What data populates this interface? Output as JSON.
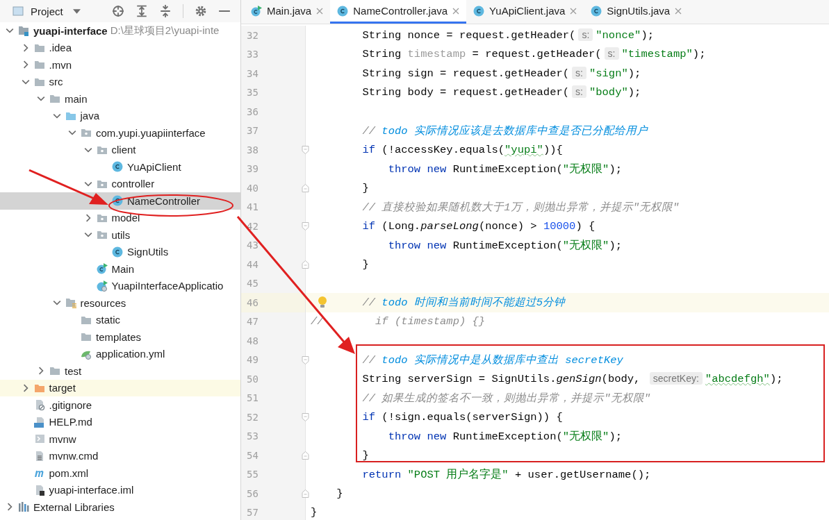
{
  "project_panel": {
    "title": "Project",
    "tree": [
      {
        "label": "yuapi-interface",
        "path": "D:\\星球项目2\\yuapi-inte",
        "kind": "module",
        "expanded": true,
        "selected": false,
        "children": [
          {
            "label": ".idea",
            "kind": "folder",
            "expanded": false,
            "selected": false
          },
          {
            "label": ".mvn",
            "kind": "folder",
            "expanded": false,
            "selected": false
          },
          {
            "label": "src",
            "kind": "folder",
            "expanded": true,
            "selected": false,
            "children": [
              {
                "label": "main",
                "kind": "folder",
                "expanded": true,
                "selected": false,
                "children": [
                  {
                    "label": "java",
                    "kind": "source",
                    "expanded": true,
                    "selected": false,
                    "children": [
                      {
                        "label": "com.yupi.yuapiinterface",
                        "kind": "package",
                        "expanded": true,
                        "selected": false,
                        "children": [
                          {
                            "label": "client",
                            "kind": "package",
                            "expanded": true,
                            "selected": false,
                            "children": [
                              {
                                "label": "YuApiClient",
                                "kind": "class",
                                "selected": false
                              }
                            ]
                          },
                          {
                            "label": "controller",
                            "kind": "package",
                            "expanded": true,
                            "selected": false,
                            "children": [
                              {
                                "label": "NameController",
                                "kind": "class",
                                "selected": true
                              }
                            ]
                          },
                          {
                            "label": "model",
                            "kind": "package",
                            "expanded": false,
                            "selected": false
                          },
                          {
                            "label": "utils",
                            "kind": "package",
                            "expanded": true,
                            "selected": false,
                            "children": [
                              {
                                "label": "SignUtils",
                                "kind": "class",
                                "selected": false
                              }
                            ]
                          },
                          {
                            "label": "Main",
                            "kind": "runnable",
                            "selected": false
                          },
                          {
                            "label": "YuapiInterfaceApplicatio",
                            "kind": "spring",
                            "selected": false
                          }
                        ]
                      }
                    ]
                  },
                  {
                    "label": "resources",
                    "kind": "resources",
                    "expanded": true,
                    "selected": false,
                    "children": [
                      {
                        "label": "static",
                        "kind": "folder",
                        "selected": false
                      },
                      {
                        "label": "templates",
                        "kind": "folder",
                        "selected": false
                      },
                      {
                        "label": "application.yml",
                        "kind": "config",
                        "selected": false
                      }
                    ]
                  }
                ]
              },
              {
                "label": "test",
                "kind": "folder",
                "expanded": false,
                "selected": false
              }
            ]
          },
          {
            "label": "target",
            "kind": "excluded",
            "expanded": false,
            "selected": false
          },
          {
            "label": ".gitignore",
            "kind": "ignore",
            "selected": false
          },
          {
            "label": "HELP.md",
            "kind": "markdown",
            "selected": false
          },
          {
            "label": "mvnw",
            "kind": "script",
            "selected": false
          },
          {
            "label": "mvnw.cmd",
            "kind": "text",
            "selected": false
          },
          {
            "label": "pom.xml",
            "kind": "maven",
            "selected": false
          },
          {
            "label": "yuapi-interface.iml",
            "kind": "iml",
            "selected": false
          }
        ]
      },
      {
        "label": "External Libraries",
        "kind": "library",
        "expanded": false,
        "selected": false
      }
    ]
  },
  "tabs": [
    {
      "label": "Main.java",
      "kind": "runnable",
      "selected": false
    },
    {
      "label": "NameController.java",
      "kind": "class",
      "selected": true
    },
    {
      "label": "YuApiClient.java",
      "kind": "class",
      "selected": false
    },
    {
      "label": "SignUtils.java",
      "kind": "class",
      "selected": false
    }
  ],
  "editor": {
    "lines": [
      {
        "num": "32",
        "kind": "plain",
        "current": false,
        "tokens": [
          {
            "kind": "plain",
            "text": "        String nonce = request.getHeader("
          },
          {
            "kind": "hint",
            "text": "s:"
          },
          {
            "kind": "string",
            "text": "\"nonce\""
          },
          {
            "kind": "plain",
            "text": ");"
          }
        ]
      },
      {
        "num": "33",
        "kind": "plain",
        "current": false,
        "tokens": [
          {
            "kind": "plain",
            "text": "        String "
          },
          {
            "kind": "unused",
            "text": "timestamp"
          },
          {
            "kind": "plain",
            "text": " = request.getHeader("
          },
          {
            "kind": "hint",
            "text": "s:"
          },
          {
            "kind": "string",
            "text": "\"timestamp\""
          },
          {
            "kind": "plain",
            "text": ");"
          }
        ]
      },
      {
        "num": "34",
        "kind": "plain",
        "current": false,
        "tokens": [
          {
            "kind": "plain",
            "text": "        String sign = request.getHeader("
          },
          {
            "kind": "hint",
            "text": "s:"
          },
          {
            "kind": "string",
            "text": "\"sign\""
          },
          {
            "kind": "plain",
            "text": ");"
          }
        ]
      },
      {
        "num": "35",
        "kind": "plain",
        "current": false,
        "tokens": [
          {
            "kind": "plain",
            "text": "        String body = request.getHeader("
          },
          {
            "kind": "hint",
            "text": "s:"
          },
          {
            "kind": "string",
            "text": "\"body\""
          },
          {
            "kind": "plain",
            "text": ");"
          }
        ]
      },
      {
        "num": "36",
        "kind": "plain",
        "current": false
      },
      {
        "num": "37",
        "kind": "plain",
        "current": false,
        "tokens": [
          {
            "kind": "comment",
            "text": "        // "
          },
          {
            "kind": "todo",
            "text": "todo 实际情况应该是去数据库中查是否已分配给用户"
          }
        ]
      },
      {
        "num": "38",
        "kind": "fold-start",
        "current": false,
        "tokens": [
          {
            "kind": "keyword",
            "text": "        if"
          },
          {
            "kind": "plain",
            "text": " (!accessKey.equals("
          },
          {
            "kind": "typo",
            "text": "\"yupi\""
          },
          {
            "kind": "plain",
            "text": ")){"
          }
        ]
      },
      {
        "num": "39",
        "kind": "plain",
        "current": false,
        "tokens": [
          {
            "kind": "keyword",
            "text": "            throw new"
          },
          {
            "kind": "plain",
            "text": " RuntimeException("
          },
          {
            "kind": "string",
            "text": "\"无权限\""
          },
          {
            "kind": "plain",
            "text": ");"
          }
        ]
      },
      {
        "num": "40",
        "kind": "fold-end",
        "current": false,
        "tokens": [
          {
            "kind": "plain",
            "text": "        }"
          }
        ]
      },
      {
        "num": "41",
        "kind": "plain",
        "current": false,
        "tokens": [
          {
            "kind": "comment",
            "text": "        // 直接校验如果随机数大于1万，则抛出异常，并提示\"无权限\""
          }
        ]
      },
      {
        "num": "42",
        "kind": "fold-start",
        "current": false,
        "tokens": [
          {
            "kind": "keyword",
            "text": "        if"
          },
          {
            "kind": "plain",
            "text": " (Long."
          },
          {
            "kind": "italic",
            "text": "parseLong"
          },
          {
            "kind": "plain",
            "text": "(nonce) > "
          },
          {
            "kind": "number",
            "text": "10000"
          },
          {
            "kind": "plain",
            "text": ") {"
          }
        ]
      },
      {
        "num": "43",
        "kind": "plain",
        "current": false,
        "tokens": [
          {
            "kind": "keyword",
            "text": "            throw new"
          },
          {
            "kind": "plain",
            "text": " RuntimeException("
          },
          {
            "kind": "string",
            "text": "\"无权限\""
          },
          {
            "kind": "plain",
            "text": ");"
          }
        ]
      },
      {
        "num": "44",
        "kind": "fold-end",
        "current": false,
        "tokens": [
          {
            "kind": "plain",
            "text": "        }"
          }
        ]
      },
      {
        "num": "45",
        "kind": "plain",
        "current": false
      },
      {
        "num": "46",
        "kind": "bulb",
        "current": true,
        "tokens": [
          {
            "kind": "comment",
            "text": "        // "
          },
          {
            "kind": "todo",
            "text": "todo 时间和当前时间不能超过5分钟"
          }
        ]
      },
      {
        "num": "47",
        "kind": "plain",
        "current": false,
        "tokens": [
          {
            "kind": "comment",
            "text": "//        if (timestamp) {}"
          }
        ]
      },
      {
        "num": "48",
        "kind": "plain",
        "current": false
      },
      {
        "num": "49",
        "kind": "fold-start",
        "current": false,
        "tokens": [
          {
            "kind": "comment",
            "text": "        // "
          },
          {
            "kind": "todo",
            "text": "todo 实际情况中是从数据库中查出 secretKey"
          }
        ]
      },
      {
        "num": "50",
        "kind": "plain",
        "current": false,
        "tokens": [
          {
            "kind": "plain",
            "text": "        String serverSign = SignUtils."
          },
          {
            "kind": "italic",
            "text": "genSign"
          },
          {
            "kind": "plain",
            "text": "(body, "
          },
          {
            "kind": "hint",
            "text": "secretKey:"
          },
          {
            "kind": "typo",
            "text": "\"abcdefgh\""
          },
          {
            "kind": "plain",
            "text": ");"
          }
        ]
      },
      {
        "num": "51",
        "kind": "plain",
        "current": false,
        "tokens": [
          {
            "kind": "comment",
            "text": "        // 如果生成的签名不一致，则抛出异常，并提示\"无权限\""
          }
        ]
      },
      {
        "num": "52",
        "kind": "fold-start",
        "current": false,
        "tokens": [
          {
            "kind": "keyword",
            "text": "        if"
          },
          {
            "kind": "plain",
            "text": " (!sign.equals(serverSign)) {"
          }
        ]
      },
      {
        "num": "53",
        "kind": "plain",
        "current": false,
        "tokens": [
          {
            "kind": "keyword",
            "text": "            throw new"
          },
          {
            "kind": "plain",
            "text": " RuntimeException("
          },
          {
            "kind": "string",
            "text": "\"无权限\""
          },
          {
            "kind": "plain",
            "text": ");"
          }
        ]
      },
      {
        "num": "54",
        "kind": "fold-end",
        "current": false,
        "tokens": [
          {
            "kind": "plain",
            "text": "        }"
          }
        ]
      },
      {
        "num": "55",
        "kind": "plain",
        "current": false,
        "tokens": [
          {
            "kind": "keyword",
            "text": "        return"
          },
          {
            "kind": "string",
            "text": " \"POST 用户名字是\""
          },
          {
            "kind": "plain",
            "text": " + user.getUsername();"
          }
        ]
      },
      {
        "num": "56",
        "kind": "fold-end",
        "current": false,
        "tokens": [
          {
            "kind": "plain",
            "text": "    }"
          }
        ]
      },
      {
        "num": "57",
        "kind": "plain",
        "current": false,
        "tokens": [
          {
            "kind": "plain",
            "text": "}"
          }
        ]
      }
    ]
  }
}
